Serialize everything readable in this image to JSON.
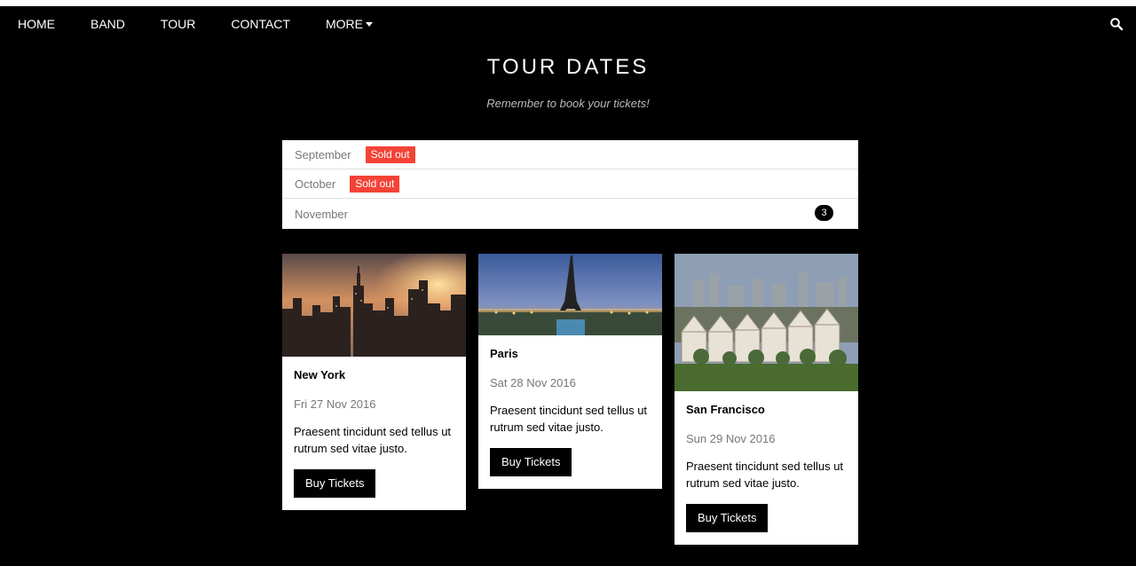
{
  "nav": {
    "items": [
      "HOME",
      "BAND",
      "TOUR",
      "CONTACT"
    ],
    "more_label": "MORE",
    "search_icon": "search-icon"
  },
  "header": {
    "title": "TOUR DATES",
    "subtitle": "Remember to book your tickets!"
  },
  "months": [
    {
      "name": "September",
      "badge": "Sold out"
    },
    {
      "name": "October",
      "badge": "Sold out"
    },
    {
      "name": "November",
      "count": "3"
    }
  ],
  "cards": [
    {
      "city": "New York",
      "date": "Fri 27 Nov 2016",
      "description": "Praesent tincidunt sed tellus ut rutrum sed vitae justo.",
      "button": "Buy Tickets"
    },
    {
      "city": "Paris",
      "date": "Sat 28 Nov 2016",
      "description": "Praesent tincidunt sed tellus ut rutrum sed vitae justo.",
      "button": "Buy Tickets"
    },
    {
      "city": "San Francisco",
      "date": "Sun 29 Nov 2016",
      "description": "Praesent tincidunt sed tellus ut rutrum sed vitae justo.",
      "button": "Buy Tickets"
    }
  ],
  "colors": {
    "background": "#000000",
    "sold_out": "#f44336",
    "card": "#ffffff"
  }
}
